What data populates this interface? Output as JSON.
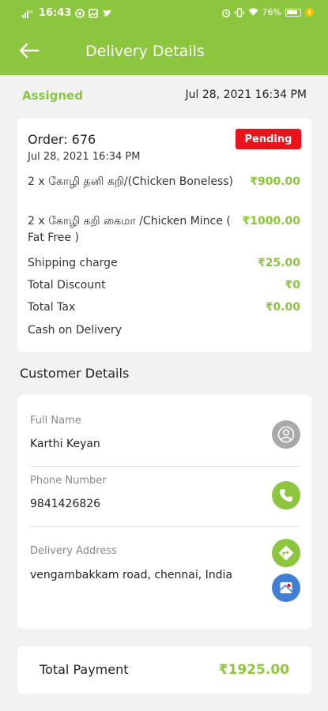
{
  "status_bar": {
    "time": "16:43",
    "battery": "76%",
    "icons": [
      "signal-4g-icon",
      "whatsapp-icon",
      "photo-icon",
      "twitter-icon",
      "alarm-icon",
      "vibrate-icon",
      "wifi-icon",
      "battery-icon",
      "charging-icon"
    ]
  },
  "header": {
    "title": "Delivery Details",
    "back_icon": "arrow-left-icon"
  },
  "order_status": {
    "label": "Assigned",
    "datetime": "Jul 28, 2021 16:34 PM"
  },
  "order": {
    "number": "Order: 676",
    "date": "Jul 28, 2021 16:34 PM",
    "badge": "Pending",
    "items": [
      {
        "name": "2 x கோழி  தனி கறி/(Chicken Boneless)",
        "price": "₹900.00"
      },
      {
        "name": "2 x கோழி  கறி கைமா /Chicken Mince ( Fat Free )",
        "price": "₹1000.00"
      }
    ],
    "shipping": {
      "label": "Shipping charge",
      "value": "₹25.00"
    },
    "discount": {
      "label": "Total Discount",
      "value": "₹0"
    },
    "tax": {
      "label": "Total Tax",
      "value": "₹0.00"
    },
    "payment_method": "Cash on Delivery"
  },
  "customer": {
    "section_title": "Customer Details",
    "full_name_label": "Full Name",
    "full_name": "Karthi Keyan",
    "phone_label": "Phone Number",
    "phone": "9841426826",
    "address_label": "Delivery Address",
    "address": "vengambakkam road, chennai, India"
  },
  "total": {
    "label": "Total Payment",
    "value": "₹1925.00"
  },
  "colors": {
    "primary_green": "#8cc63f",
    "badge_red": "#e8141b",
    "avatar_grey": "#a9a9a9",
    "map_blue": "#3f7fd6"
  }
}
